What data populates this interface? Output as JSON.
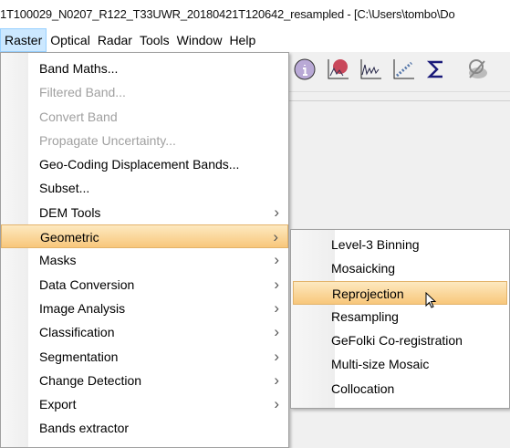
{
  "window": {
    "title": "1T100029_N0207_R122_T33UWR_20180421T120642_resampled - [C:\\Users\\tombo\\Do"
  },
  "menubar": [
    {
      "label": "Raster",
      "active": true
    },
    {
      "label": "Optical"
    },
    {
      "label": "Radar"
    },
    {
      "label": "Tools"
    },
    {
      "label": "Window"
    },
    {
      "label": "Help"
    }
  ],
  "toolbar": {
    "icons": [
      "information-icon",
      "pixel-info-icon",
      "spectrum-icon",
      "scatter-plot-icon",
      "statistics-sigma-icon",
      "hide-layer-icon"
    ]
  },
  "raster_menu": {
    "items": [
      {
        "label": "Band Maths..."
      },
      {
        "label": "Filtered Band...",
        "disabled": true
      },
      {
        "label": "Convert Band",
        "disabled": true
      },
      {
        "label": "Propagate Uncertainty...",
        "disabled": true
      },
      {
        "label": "Geo-Coding Displacement Bands..."
      },
      {
        "label": "Subset..."
      },
      {
        "label": "DEM Tools",
        "submenu": true
      },
      {
        "label": "Geometric",
        "submenu": true,
        "highlighted": true
      },
      {
        "label": "Masks",
        "submenu": true
      },
      {
        "label": "Data Conversion",
        "submenu": true
      },
      {
        "label": "Image Analysis",
        "submenu": true
      },
      {
        "label": "Classification",
        "submenu": true
      },
      {
        "label": "Segmentation",
        "submenu": true
      },
      {
        "label": "Change Detection",
        "submenu": true
      },
      {
        "label": "Export",
        "submenu": true
      },
      {
        "label": "Bands extractor"
      }
    ]
  },
  "geometric_submenu": {
    "items": [
      {
        "label": "Level-3 Binning"
      },
      {
        "label": "Mosaicking"
      },
      {
        "label": "Reprojection",
        "highlighted": true
      },
      {
        "label": "Resampling"
      },
      {
        "label": "GeFolki Co-registration"
      },
      {
        "label": "Multi-size Mosaic"
      },
      {
        "label": "Collocation"
      }
    ]
  },
  "colors": {
    "highlight": "#f8c77b",
    "menubar_active": "#cce8ff",
    "disabled_text": "#a0a0a0"
  }
}
